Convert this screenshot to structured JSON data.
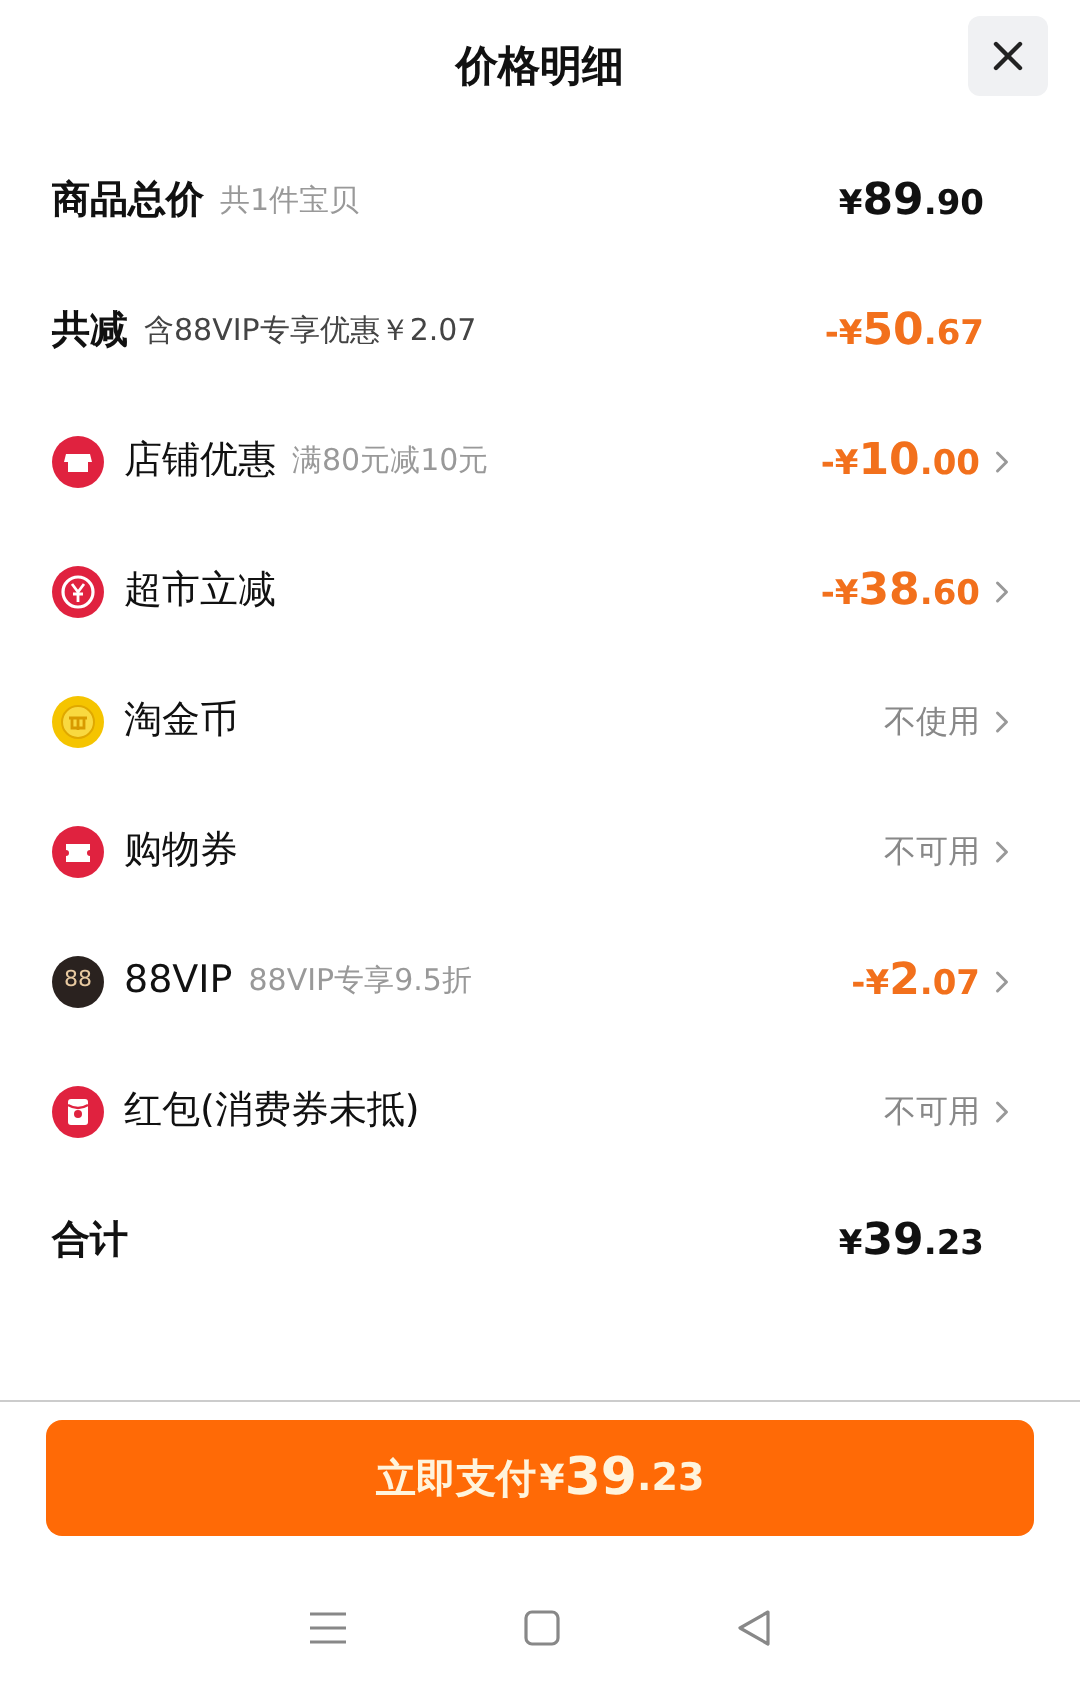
{
  "header": {
    "title": "价格明细"
  },
  "rows": [
    {
      "kind": "summary",
      "label": "商品总价",
      "note": "共1件宝贝",
      "amount": {
        "deduction": false,
        "sign": "¥",
        "int": "89",
        "dec": ".90"
      }
    },
    {
      "kind": "summary",
      "label": "共减",
      "note": "含88VIP专享优惠￥2.07",
      "amount": {
        "deduction": true,
        "sign": "-¥",
        "int": "50",
        "dec": ".67"
      }
    },
    {
      "kind": "shop",
      "label": "店铺优惠",
      "note": "满80元减10元",
      "amount": {
        "deduction": true,
        "sign": "-¥",
        "int": "10",
        "dec": ".00"
      }
    },
    {
      "kind": "market",
      "label": "超市立减",
      "amount": {
        "deduction": true,
        "sign": "-¥",
        "int": "38",
        "dec": ".60"
      }
    },
    {
      "kind": "coin",
      "label": "淘金币",
      "status": "不使用"
    },
    {
      "kind": "voucher",
      "label": "购物券",
      "status": "不可用"
    },
    {
      "kind": "vip",
      "badge": "88",
      "label": "88VIP",
      "note": "88VIP专享9.5折",
      "amount": {
        "deduction": true,
        "sign": "-¥",
        "int": "2",
        "dec": ".07"
      }
    },
    {
      "kind": "packet",
      "label": "红包(消费券未抵)",
      "status": "不可用"
    },
    {
      "kind": "summary",
      "label": "合计",
      "amount": {
        "deduction": false,
        "sign": "¥",
        "int": "39",
        "dec": ".23"
      }
    }
  ],
  "pay_button": {
    "label": "立即支付",
    "sign": "¥",
    "int": "39",
    "dec": ".23"
  }
}
